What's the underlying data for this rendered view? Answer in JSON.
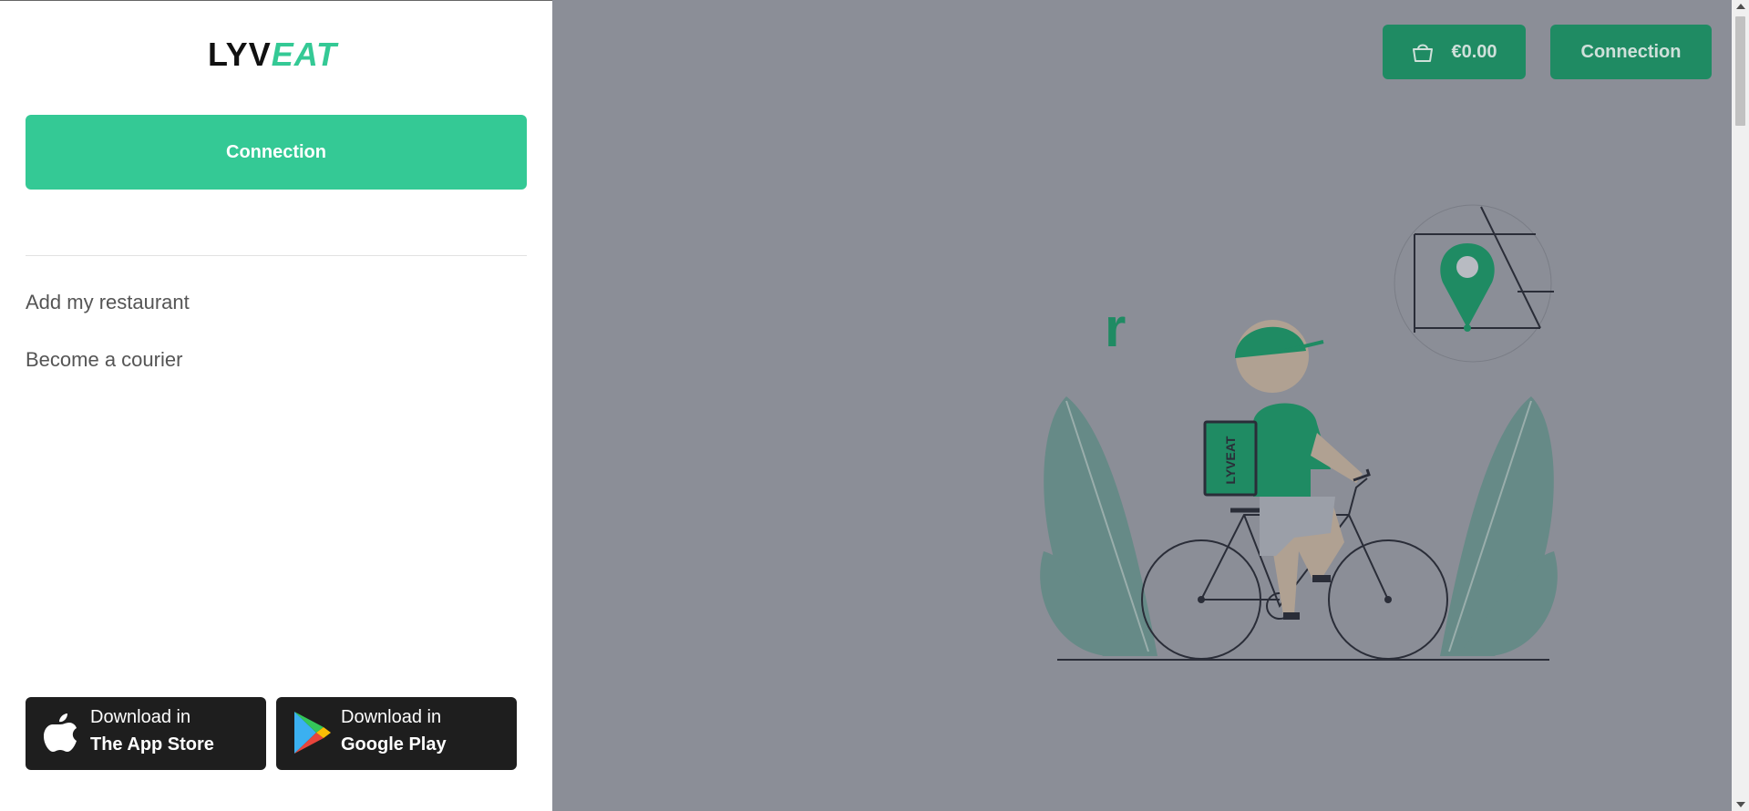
{
  "header": {
    "cart_amount": "€0.00",
    "connection_label": "Connection"
  },
  "hero": {
    "visible_fragment": "r"
  },
  "drawer": {
    "logo": {
      "part1": "LYV",
      "part2": "EAT"
    },
    "connection_label": "Connection",
    "menu": [
      {
        "label": "Add my restaurant"
      },
      {
        "label": "Become a courier"
      }
    ],
    "stores": [
      {
        "line1": "Download in",
        "line2": "The App Store",
        "icon": "apple-icon"
      },
      {
        "line1": "Download in",
        "line2": "Google Play",
        "icon": "google-play-icon"
      }
    ]
  },
  "illustration": {
    "bag_text": "LYVEAT"
  },
  "colors": {
    "brand": "#34c995",
    "brand_dark": "#1f8b63",
    "overlay": "#8b8e97",
    "store_button": "#1e1e1e"
  }
}
